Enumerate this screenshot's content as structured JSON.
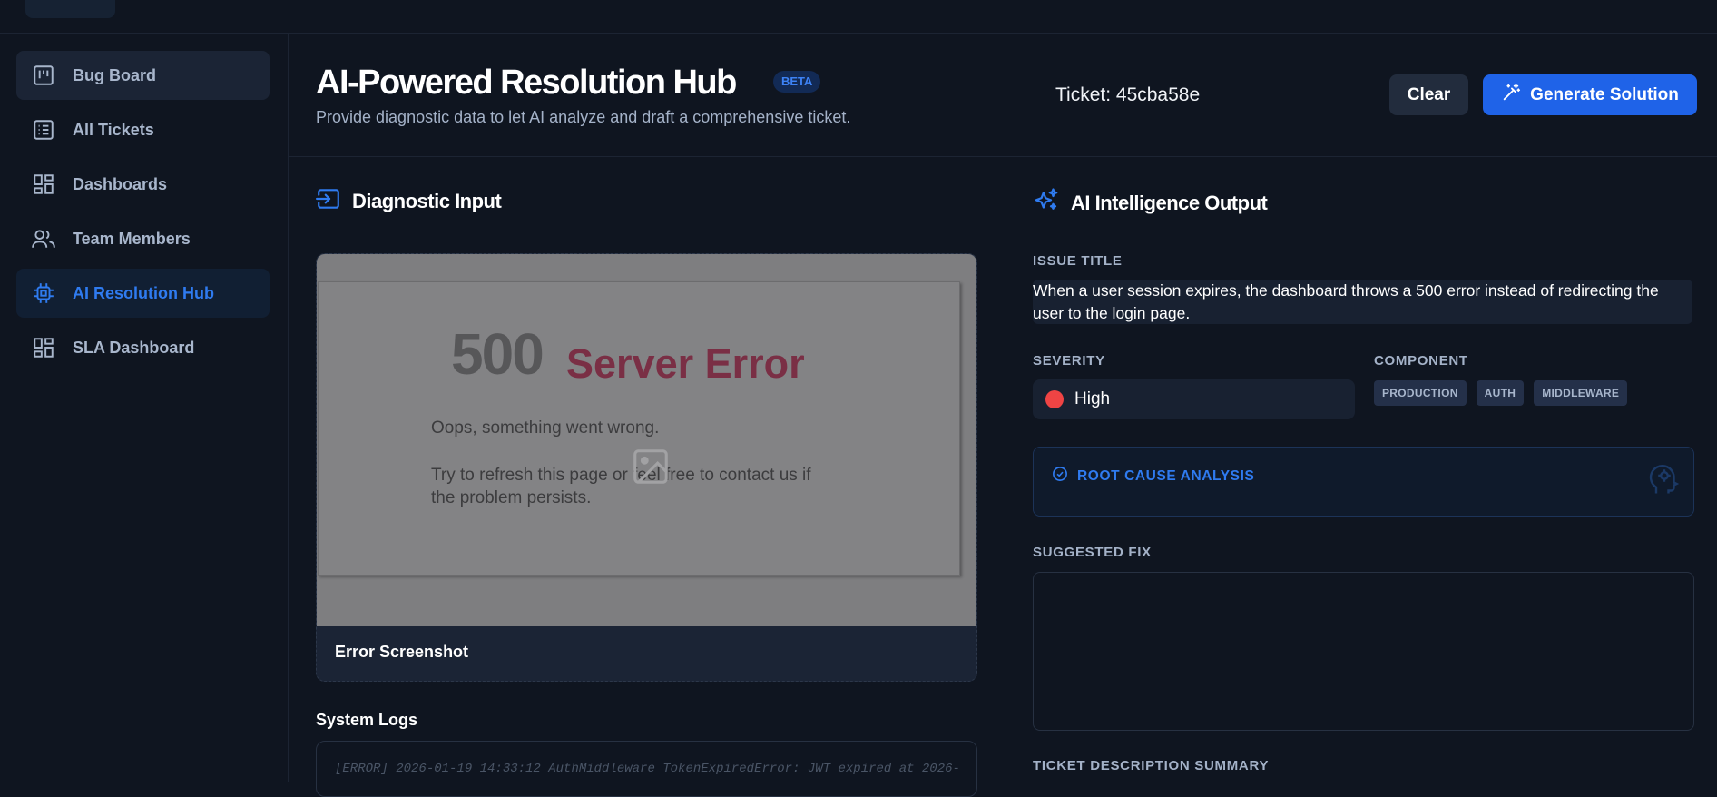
{
  "sidebar": {
    "items": [
      {
        "label": "Bug Board",
        "icon": "kanban-board-icon",
        "state": "hover"
      },
      {
        "label": "All Tickets",
        "icon": "list-icon",
        "state": "normal"
      },
      {
        "label": "Dashboards",
        "icon": "dashboard-grid-icon",
        "state": "normal"
      },
      {
        "label": "Team Members",
        "icon": "users-icon",
        "state": "normal"
      },
      {
        "label": "AI Resolution Hub",
        "icon": "chip-icon",
        "state": "active"
      },
      {
        "label": "SLA Dashboard",
        "icon": "dashboard-grid-icon",
        "state": "normal"
      }
    ]
  },
  "header": {
    "title": "AI-Powered Resolution Hub",
    "badge": "BETA",
    "subtitle": "Provide diagnostic data to let AI analyze and draft a comprehensive ticket.",
    "ticket": "Ticket: 45cba58e",
    "clear_label": "Clear",
    "generate_label": "Generate Solution"
  },
  "diagnostic": {
    "title": "Diagnostic Input",
    "screenshot": {
      "error_code": "500",
      "error_title": "Server Error",
      "line1": "Oops, something went wrong.",
      "line2": "Try to refresh this page or feel free to contact us if the problem persists.",
      "caption": "Error Screenshot"
    },
    "logs_label": "System Logs",
    "logs_text": "[ERROR] 2026-01-19 14:33:12 AuthMiddleware TokenExpiredError: JWT expired at 2026-"
  },
  "output": {
    "title": "AI Intelligence Output",
    "issue_title_label": "ISSUE TITLE",
    "issue_title": "When a user session expires, the dashboard throws a 500 error instead of redirecting the user to the login page.",
    "severity_label": "SEVERITY",
    "severity": "High",
    "severity_color": "#ef4444",
    "component_label": "COMPONENT",
    "components": [
      "PRODUCTION",
      "AUTH",
      "MIDDLEWARE"
    ],
    "rca_label": "ROOT CAUSE ANALYSIS",
    "suggested_fix_label": "SUGGESTED FIX",
    "summary_label": "TICKET DESCRIPTION SUMMARY"
  },
  "colors": {
    "background": "#0f1520",
    "accent": "#1f63e8",
    "active_nav": "#2f7bf0",
    "muted_text": "#a4b2c8"
  }
}
